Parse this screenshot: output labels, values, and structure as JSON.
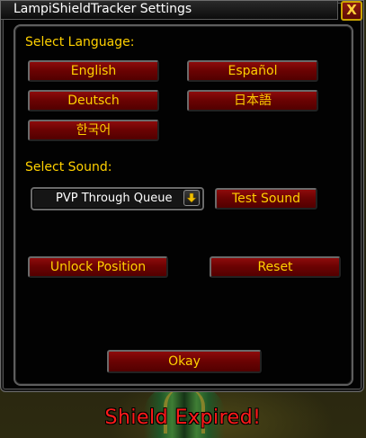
{
  "window": {
    "title": "LampiShieldTracker Settings",
    "close_label": "X"
  },
  "language": {
    "label": "Select Language:",
    "options": [
      "English",
      "Español",
      "Deutsch",
      "日本語",
      "한국어"
    ]
  },
  "sound": {
    "label": "Select Sound:",
    "selected": "PVP Through Queue",
    "test_label": "Test Sound"
  },
  "position": {
    "unlock_label": "Unlock Position",
    "reset_label": "Reset"
  },
  "okay_label": "Okay",
  "status_message": "Shield Expired!",
  "colors": {
    "label_gold": "#ffd100",
    "button_red": "#7a0505",
    "alert_red": "#ff1a1a"
  }
}
